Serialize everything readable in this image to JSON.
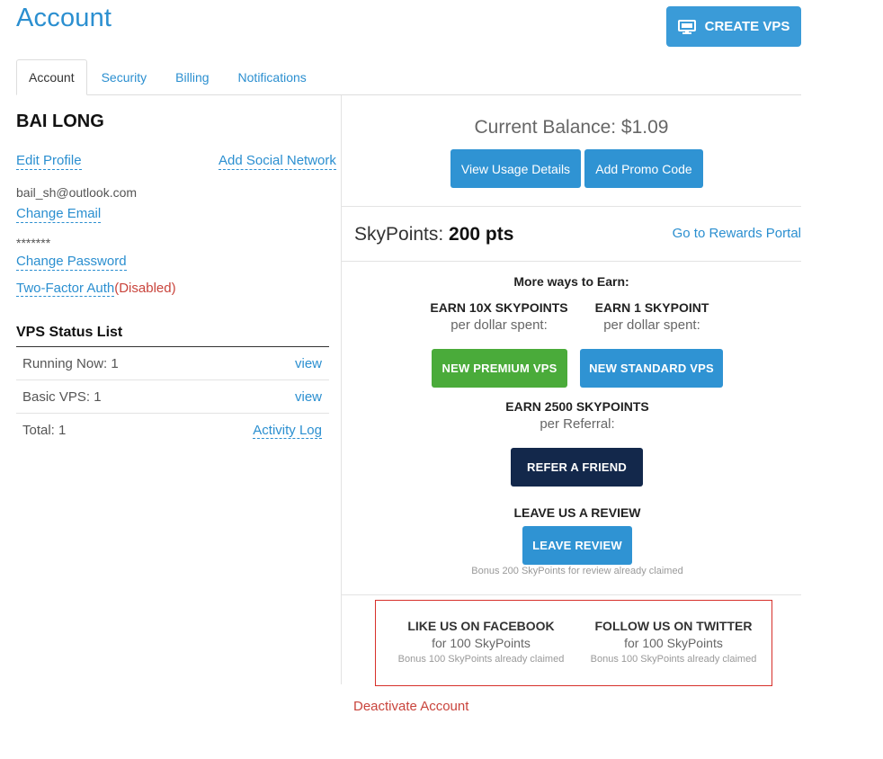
{
  "header": {
    "title": "Account",
    "create_vps_label": "CREATE VPS"
  },
  "tabs": [
    {
      "label": "Account",
      "active": true
    },
    {
      "label": "Security",
      "active": false
    },
    {
      "label": "Billing",
      "active": false
    },
    {
      "label": "Notifications",
      "active": false
    }
  ],
  "profile": {
    "name": "BAI LONG",
    "edit_profile": "Edit Profile",
    "add_social": "Add Social Network",
    "email": "bail_sh@outlook.com",
    "change_email": "Change Email",
    "password_mask": "*******",
    "change_password": "Change Password",
    "two_factor": "Two-Factor Auth",
    "two_factor_paren_open": "(",
    "two_factor_status": "Disabled",
    "two_factor_paren_close": ")"
  },
  "vps_status": {
    "title": "VPS Status List",
    "rows": [
      {
        "label": "Running Now: 1",
        "link": "view"
      },
      {
        "label": "Basic VPS: 1",
        "link": "view"
      },
      {
        "label": "Total: 1",
        "link": "Activity Log"
      }
    ]
  },
  "balance": {
    "text": "Current Balance: $1.09",
    "view_usage": "View Usage Details",
    "add_promo": "Add Promo Code"
  },
  "skypoints": {
    "label": "SkyPoints: ",
    "value": "200 pts",
    "rewards_link": "Go to Rewards Portal"
  },
  "earn": {
    "heading": "More ways to Earn:",
    "premium_title": "EARN 10X SKYPOINTS",
    "premium_sub": "per dollar spent:",
    "premium_btn": "NEW PREMIUM VPS",
    "standard_title": "EARN 1 SKYPOINT",
    "standard_sub": "per dollar spent:",
    "standard_btn": "NEW STANDARD VPS",
    "referral_title": "EARN 2500 SKYPOINTS",
    "referral_sub": "per Referral:",
    "referral_btn": "REFER A FRIEND",
    "review_title": "LEAVE US A REVIEW",
    "review_btn": "LEAVE REVIEW",
    "review_note": "Bonus 200 SkyPoints for review already claimed"
  },
  "social": {
    "facebook_title": "LIKE US ON FACEBOOK",
    "facebook_sub": "for 100 SkyPoints",
    "facebook_note": "Bonus 100 SkyPoints already claimed",
    "twitter_title": "FOLLOW US ON TWITTER",
    "twitter_sub": "for 100 SkyPoints",
    "twitter_note": "Bonus 100 SkyPoints already claimed"
  },
  "footer": {
    "deactivate": "Deactivate Account"
  },
  "colors": {
    "link_blue": "#2b8fd0",
    "button_blue": "#2f93d3",
    "premium_green": "#4aab3a",
    "navy": "#13284b",
    "alert_red": "#c9443c"
  },
  "icons": {
    "create_vps": "monitor-icon"
  }
}
